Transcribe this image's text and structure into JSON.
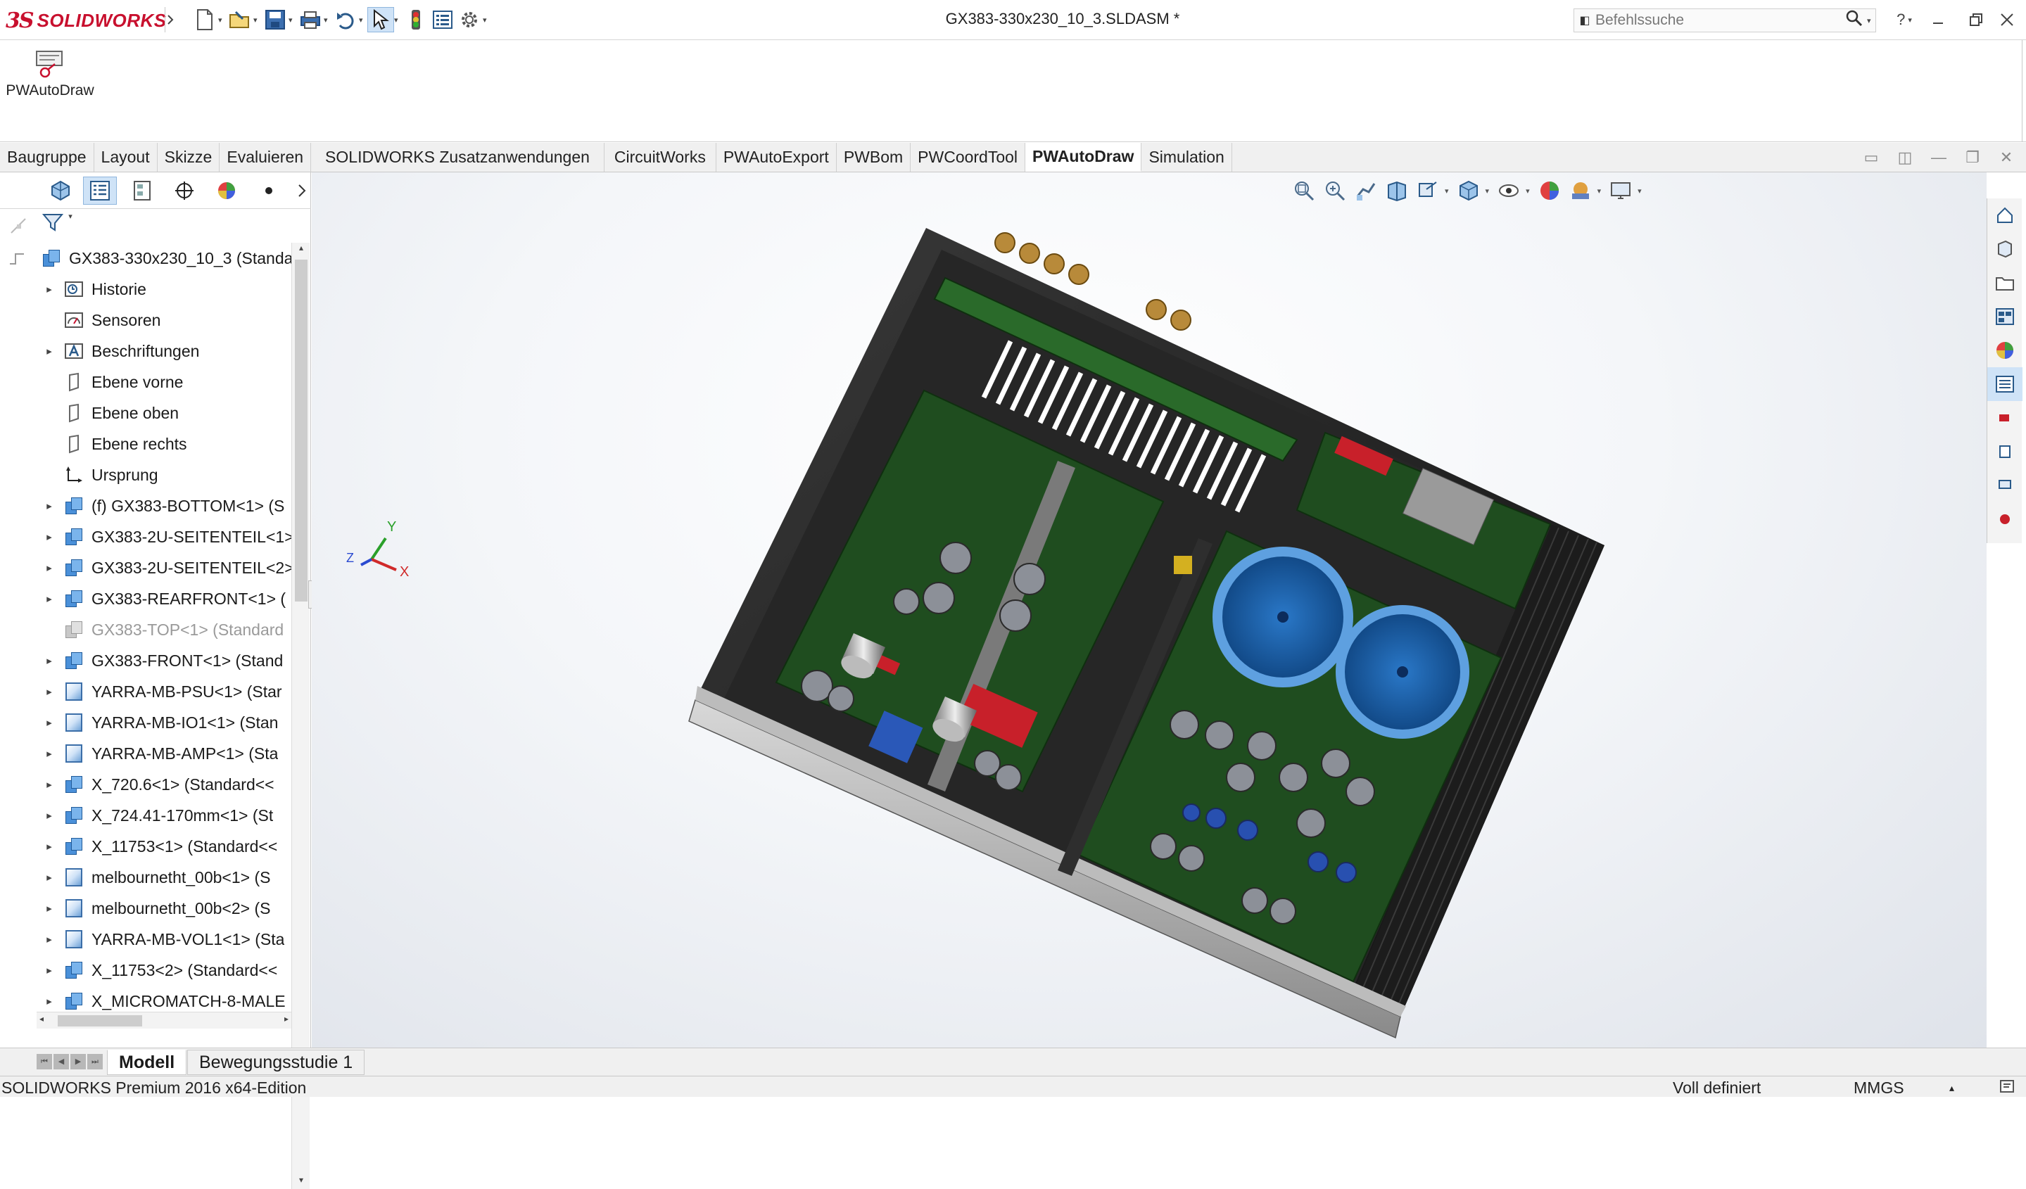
{
  "app": {
    "brand_prefix": "3S",
    "brand_name": "SOLIDWORKS",
    "document_title": "GX383-330x230_10_3.SLDASM *"
  },
  "quick_access": {
    "icons": [
      "new-document-icon",
      "open-icon",
      "save-icon",
      "print-icon",
      "undo-icon",
      "select-icon",
      "rebuild-icon",
      "file-properties-icon",
      "options-icon"
    ]
  },
  "search": {
    "placeholder": "Befehlssuche"
  },
  "window_controls": [
    "help-icon",
    "minimize-icon",
    "restore-icon",
    "close-icon"
  ],
  "ribbon": {
    "commands": [
      {
        "label": "PWAutoDraw",
        "icon": "pwautodraw-icon"
      }
    ]
  },
  "tabs": {
    "items": [
      {
        "label": "Baugruppe"
      },
      {
        "label": "Layout"
      },
      {
        "label": "Skizze"
      },
      {
        "label": "Evaluieren"
      },
      {
        "label": "SOLIDWORKS Zusatzanwendungen"
      },
      {
        "label": "CircuitWorks"
      },
      {
        "label": "PWAutoExport"
      },
      {
        "label": "PWBom"
      },
      {
        "label": "PWCoordTool"
      },
      {
        "label": "PWAutoDraw"
      },
      {
        "label": "Simulation"
      }
    ],
    "active": "PWAutoDraw"
  },
  "feature_tree": {
    "root": "GX383-330x230_10_3  (Standa",
    "nodes": [
      {
        "label": "Historie",
        "icon": "history-icon",
        "expandable": true
      },
      {
        "label": "Sensoren",
        "icon": "sensor-icon",
        "expandable": false
      },
      {
        "label": "Beschriftungen",
        "icon": "annotations-icon",
        "expandable": true
      },
      {
        "label": "Ebene vorne",
        "icon": "plane-icon",
        "expandable": false
      },
      {
        "label": "Ebene oben",
        "icon": "plane-icon",
        "expandable": false
      },
      {
        "label": "Ebene rechts",
        "icon": "plane-icon",
        "expandable": false
      },
      {
        "label": "Ursprung",
        "icon": "origin-icon",
        "expandable": false
      },
      {
        "label": "(f) GX383-BOTTOM<1> (S",
        "icon": "assembly-icon",
        "expandable": true
      },
      {
        "label": "GX383-2U-SEITENTEIL<1>",
        "icon": "assembly-icon",
        "expandable": true
      },
      {
        "label": "GX383-2U-SEITENTEIL<2>",
        "icon": "assembly-icon",
        "expandable": true
      },
      {
        "label": "GX383-REARFRONT<1> (",
        "icon": "assembly-icon",
        "expandable": true
      },
      {
        "label": "GX383-TOP<1> (Standard",
        "icon": "assembly-hidden-icon",
        "expandable": false,
        "dim": true
      },
      {
        "label": "GX383-FRONT<1> (Stand",
        "icon": "assembly-icon",
        "expandable": true
      },
      {
        "label": "YARRA-MB-PSU<1> (Star",
        "icon": "part-icon",
        "expandable": true
      },
      {
        "label": "YARRA-MB-IO1<1> (Stan",
        "icon": "part-icon",
        "expandable": true
      },
      {
        "label": "YARRA-MB-AMP<1> (Sta",
        "icon": "part-icon",
        "expandable": true
      },
      {
        "label": "X_720.6<1> (Standard<<",
        "icon": "assembly-icon",
        "expandable": true
      },
      {
        "label": "X_724.41-170mm<1> (St",
        "icon": "assembly-icon",
        "expandable": true
      },
      {
        "label": "X_11753<1> (Standard<<",
        "icon": "assembly-icon",
        "expandable": true
      },
      {
        "label": "melbournetht_00b<1> (S",
        "icon": "part-icon",
        "expandable": true
      },
      {
        "label": "melbournetht_00b<2> (S",
        "icon": "part-icon",
        "expandable": true
      },
      {
        "label": "YARRA-MB-VOL1<1> (Sta",
        "icon": "part-icon",
        "expandable": true
      },
      {
        "label": "X_11753<2> (Standard<<",
        "icon": "assembly-icon",
        "expandable": true
      },
      {
        "label": "X_MICROMATCH-8-MALE",
        "icon": "assembly-icon",
        "expandable": true
      }
    ]
  },
  "triad": {
    "x_label": "X",
    "y_label": "Y",
    "z_label": "Z"
  },
  "bottom_tabs": {
    "items": [
      "Modell",
      "Bewegungsstudie 1"
    ],
    "active": "Modell"
  },
  "status": {
    "edition": "SOLIDWORKS Premium 2016 x64-Edition",
    "definition": "Voll definiert",
    "units": "MMGS"
  },
  "colors": {
    "brand_red": "#c8102e",
    "pcb_green": "#1f4d1f",
    "chassis_black": "#1a1a1a",
    "transformer_blue": "#1a5fa8",
    "active_tab_bg": "#ffffff"
  }
}
